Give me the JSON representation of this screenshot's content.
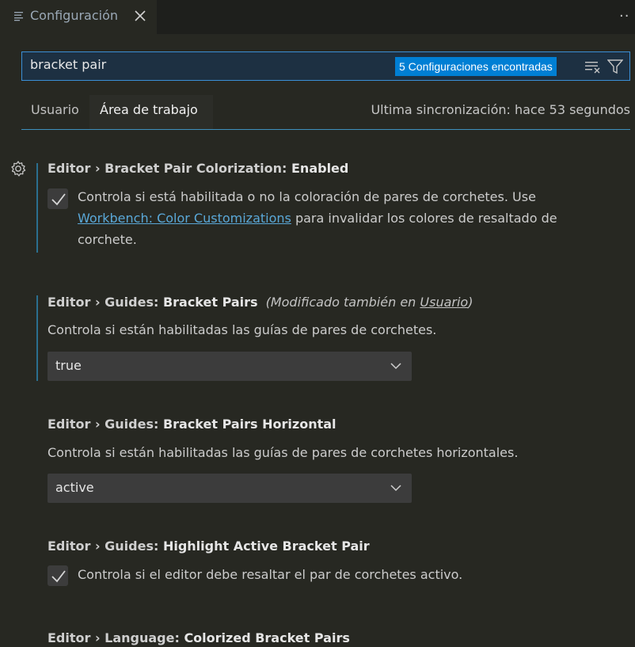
{
  "tab": {
    "title": "Configuración",
    "icon": "settings-lines-icon",
    "close_icon": "close-icon"
  },
  "search": {
    "value": "bracket pair",
    "results_badge": "5 Configuraciones encontradas"
  },
  "scope": {
    "user": "Usuario",
    "workspace": "Área de trabajo",
    "sync_status": "Ultima sincronización: hace 53 segundos"
  },
  "settings": [
    {
      "category": "Editor › Bracket Pair Colorization: ",
      "key": "Enabled",
      "type": "checkbox",
      "checked": true,
      "desc_before": "Controla si está habilitada o no la coloración de pares de corchetes. Use ",
      "desc_link": "Workbench: Color Customizations",
      "desc_after": " para invalidar los colores de resaltado de corchete."
    },
    {
      "category": "Editor › Guides: ",
      "key": "Bracket Pairs",
      "modified_prefix": "(Modificado también en ",
      "modified_link": "Usuario",
      "modified_suffix": ")",
      "type": "select",
      "desc": "Controla si están habilitadas las guías de pares de corchetes.",
      "value": "true"
    },
    {
      "category": "Editor › Guides: ",
      "key": "Bracket Pairs Horizontal",
      "type": "select",
      "desc": "Controla si están habilitadas las guías de pares de corchetes horizontales.",
      "value": "active"
    },
    {
      "category": "Editor › Guides: ",
      "key": "Highlight Active Bracket Pair",
      "type": "checkbox",
      "checked": true,
      "desc": "Controla si el editor debe resaltar el par de corchetes activo."
    },
    {
      "category": "Editor › Language: ",
      "key": "Colorized Bracket Pairs"
    }
  ],
  "colors": {
    "background": "#272822",
    "accent": "#007fd4",
    "link": "#5aa8d8",
    "focus_border": "#2b6f8f"
  }
}
